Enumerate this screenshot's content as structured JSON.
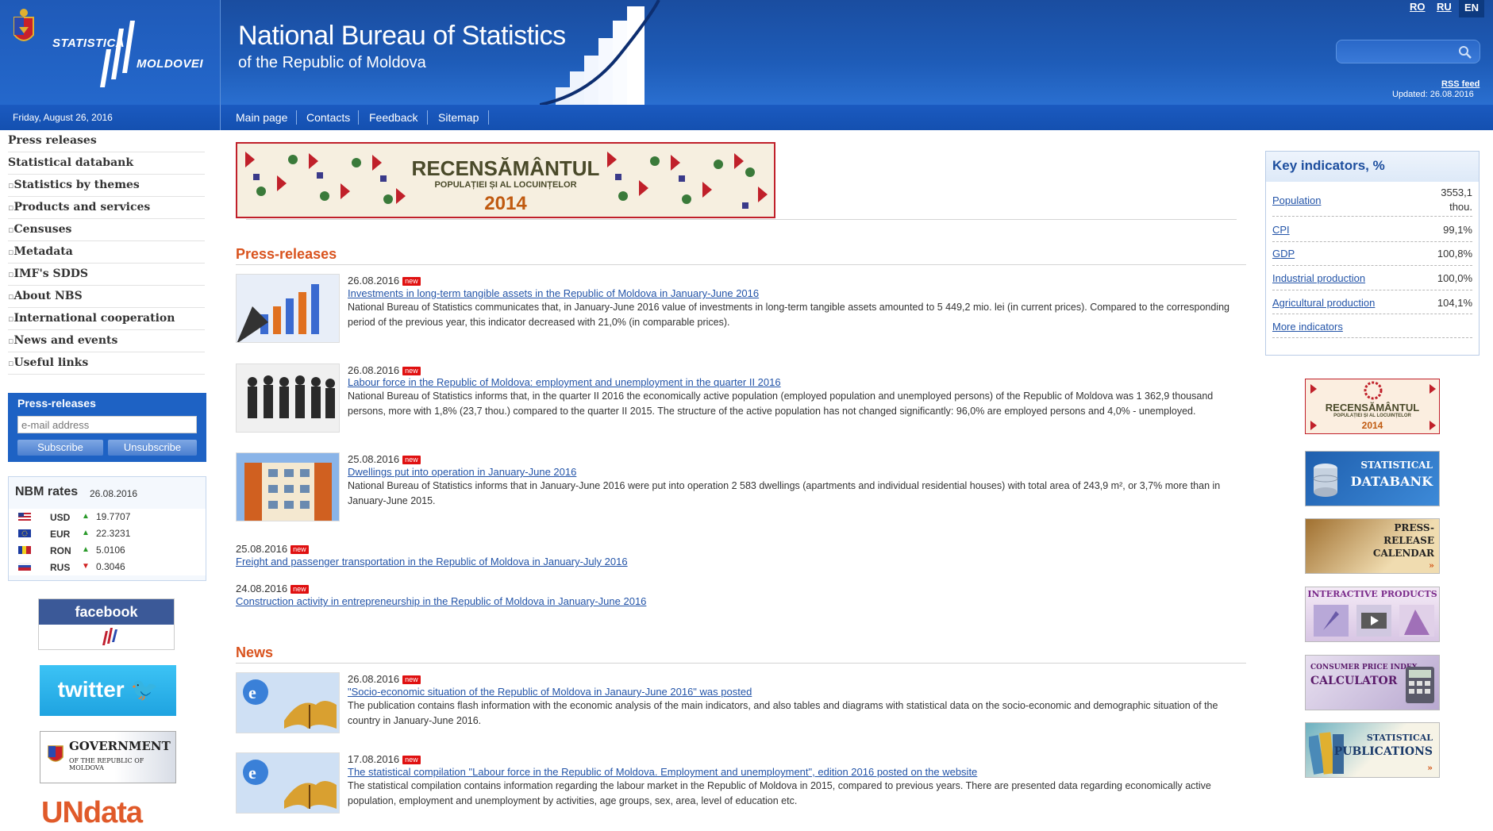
{
  "header": {
    "logo_text_1": "STATISTICA",
    "logo_text_2": "MOLDOVEI",
    "title": "National Bureau of Statistics",
    "subtitle": "of the Republic of Moldova",
    "languages": [
      "RO",
      "RU",
      "EN"
    ],
    "active_language": "EN",
    "rss_label": "RSS feed",
    "updated": "Updated: 26.08.2016",
    "search_placeholder": ""
  },
  "navbar": {
    "date": "Friday, August 26, 2016",
    "items": [
      "Main page",
      "Contacts",
      "Feedback",
      "Sitemap"
    ]
  },
  "sidebar": {
    "items": [
      "Press releases",
      "Statistical databank",
      "Statistics by themes",
      "Products and services",
      "Censuses",
      "Metadata",
      "IMF's SDDS",
      "About NBS",
      "International cooperation",
      "News and events",
      "Useful links"
    ],
    "subscribe": {
      "title": "Press-releases",
      "email_placeholder": "e-mail address",
      "subscribe_label": "Subscribe",
      "unsubscribe_label": "Unsubscribe"
    },
    "nbm": {
      "title": "NBM rates",
      "date": "26.08.2016",
      "rates": [
        {
          "currency": "USD",
          "direction": "up",
          "value": "19.7707"
        },
        {
          "currency": "EUR",
          "direction": "up",
          "value": "22.3231"
        },
        {
          "currency": "RON",
          "direction": "up",
          "value": "5.0106"
        },
        {
          "currency": "RUS",
          "direction": "down",
          "value": "0.3046"
        }
      ]
    },
    "social": {
      "facebook": "facebook",
      "twitter": "twitter",
      "gov_1": "GOVERNMENT",
      "gov_2": "OF THE REPUBLIC OF MOLDOVA",
      "undata": "UNdata"
    }
  },
  "banner": {
    "title": "RECENSĂMÂNTUL",
    "sub": "POPULAȚIEI ȘI AL LOCUINȚELOR",
    "year": "2014"
  },
  "press": {
    "title": "Press-releases",
    "new_label": "new",
    "items": [
      {
        "date": "26.08.2016",
        "link": "Investments in long-term tangible assets in the Republic of Moldova in January-June 2016",
        "desc": "National Bureau of Statistics communicates that, in January-June 2016 value of investments in long-term tangible assets amounted to 5 449,2 mio. lei (in current prices). Compared to the corresponding period of the previous year, this indicator decreased with 21,0% (in comparable prices)."
      },
      {
        "date": "26.08.2016",
        "link": "Labour force in the Republic of Moldova: employment and unemployment in the quarter II 2016",
        "desc": "National Bureau of Statistics informs that, in the quarter II 2016 the economically active population (employed population and unemployed persons) of the Republic of Moldova was 1 362,9 thousand persons, more with 1,8% (23,7 thou.) compared to the quarter II 2015. The structure of the active population has not changed significantly: 96,0% are employed persons and 4,0% - unemployed."
      },
      {
        "date": "25.08.2016",
        "link": "Dwellings put into operation in January-June 2016",
        "desc": "National Bureau of Statistics informs that in January-June 2016 were put into operation 2 583 dwellings (apartments and individual residential houses) with total area of 243,9 m², or 3,7% more than in January-June 2015."
      },
      {
        "date": "25.08.2016",
        "link": "Freight and passenger transportation in the Republic of Moldova in January-July 2016"
      },
      {
        "date": "24.08.2016",
        "link": "Construction activity in entrepreneurship in the Republic of Moldova in January-June 2016"
      }
    ]
  },
  "news": {
    "title": "News",
    "items": [
      {
        "date": "26.08.2016",
        "link": "\"Socio-economic situation of the Republic of Moldova in Janaury-June 2016\" was posted",
        "desc": "The publication contains flash information with the economic analysis of the main indicators, and also tables and diagrams with statistical data on the socio-economic and demographic situation of the country in January-June 2016."
      },
      {
        "date": "17.08.2016",
        "link": "The statistical compilation \"Labour force in the Republic of Moldova. Employment and unemployment\", edition 2016 posted on the website",
        "desc": "The statistical compilation contains information regarding the labour market in the Republic of Moldova in 2015, compared to previous years. There are presented data regarding economically active population, employment and unemployment by activities, age groups, sex, area, level of education etc."
      }
    ]
  },
  "key_indicators": {
    "title": "Key indicators, %",
    "rows": [
      {
        "name": "Population",
        "value": "3553,1",
        "value2": "thou."
      },
      {
        "name": "CPI",
        "value": "99,1%"
      },
      {
        "name": "GDP",
        "value": "100,8%"
      },
      {
        "name": "Industrial production",
        "value": "100,0%"
      },
      {
        "name": "Agricultural production",
        "value": "104,1%"
      }
    ],
    "more": "More indicators"
  },
  "promos": {
    "census_1": "RECENSĂMÂNTUL",
    "census_2": "POPULAȚIEI ȘI AL LOCUINȚELOR",
    "census_year": "2014",
    "databank_1": "STATISTICAL",
    "databank_2": "DATABANK",
    "calendar_1": "PRESS-",
    "calendar_2": "RELEASE",
    "calendar_3": "CALENDAR",
    "interactive": "INTERACTIVE PRODUCTS",
    "cpi_1": "CONSUMER PRICE INDEX",
    "cpi_2": "CALCULATOR",
    "pub_1": "STATISTICAL",
    "pub_2": "PUBLICATIONS"
  },
  "colors": {
    "header_blue": "#1e5cb8",
    "accent_orange": "#d9531e",
    "link_blue": "#2354a8",
    "new_badge": "#e01010"
  }
}
